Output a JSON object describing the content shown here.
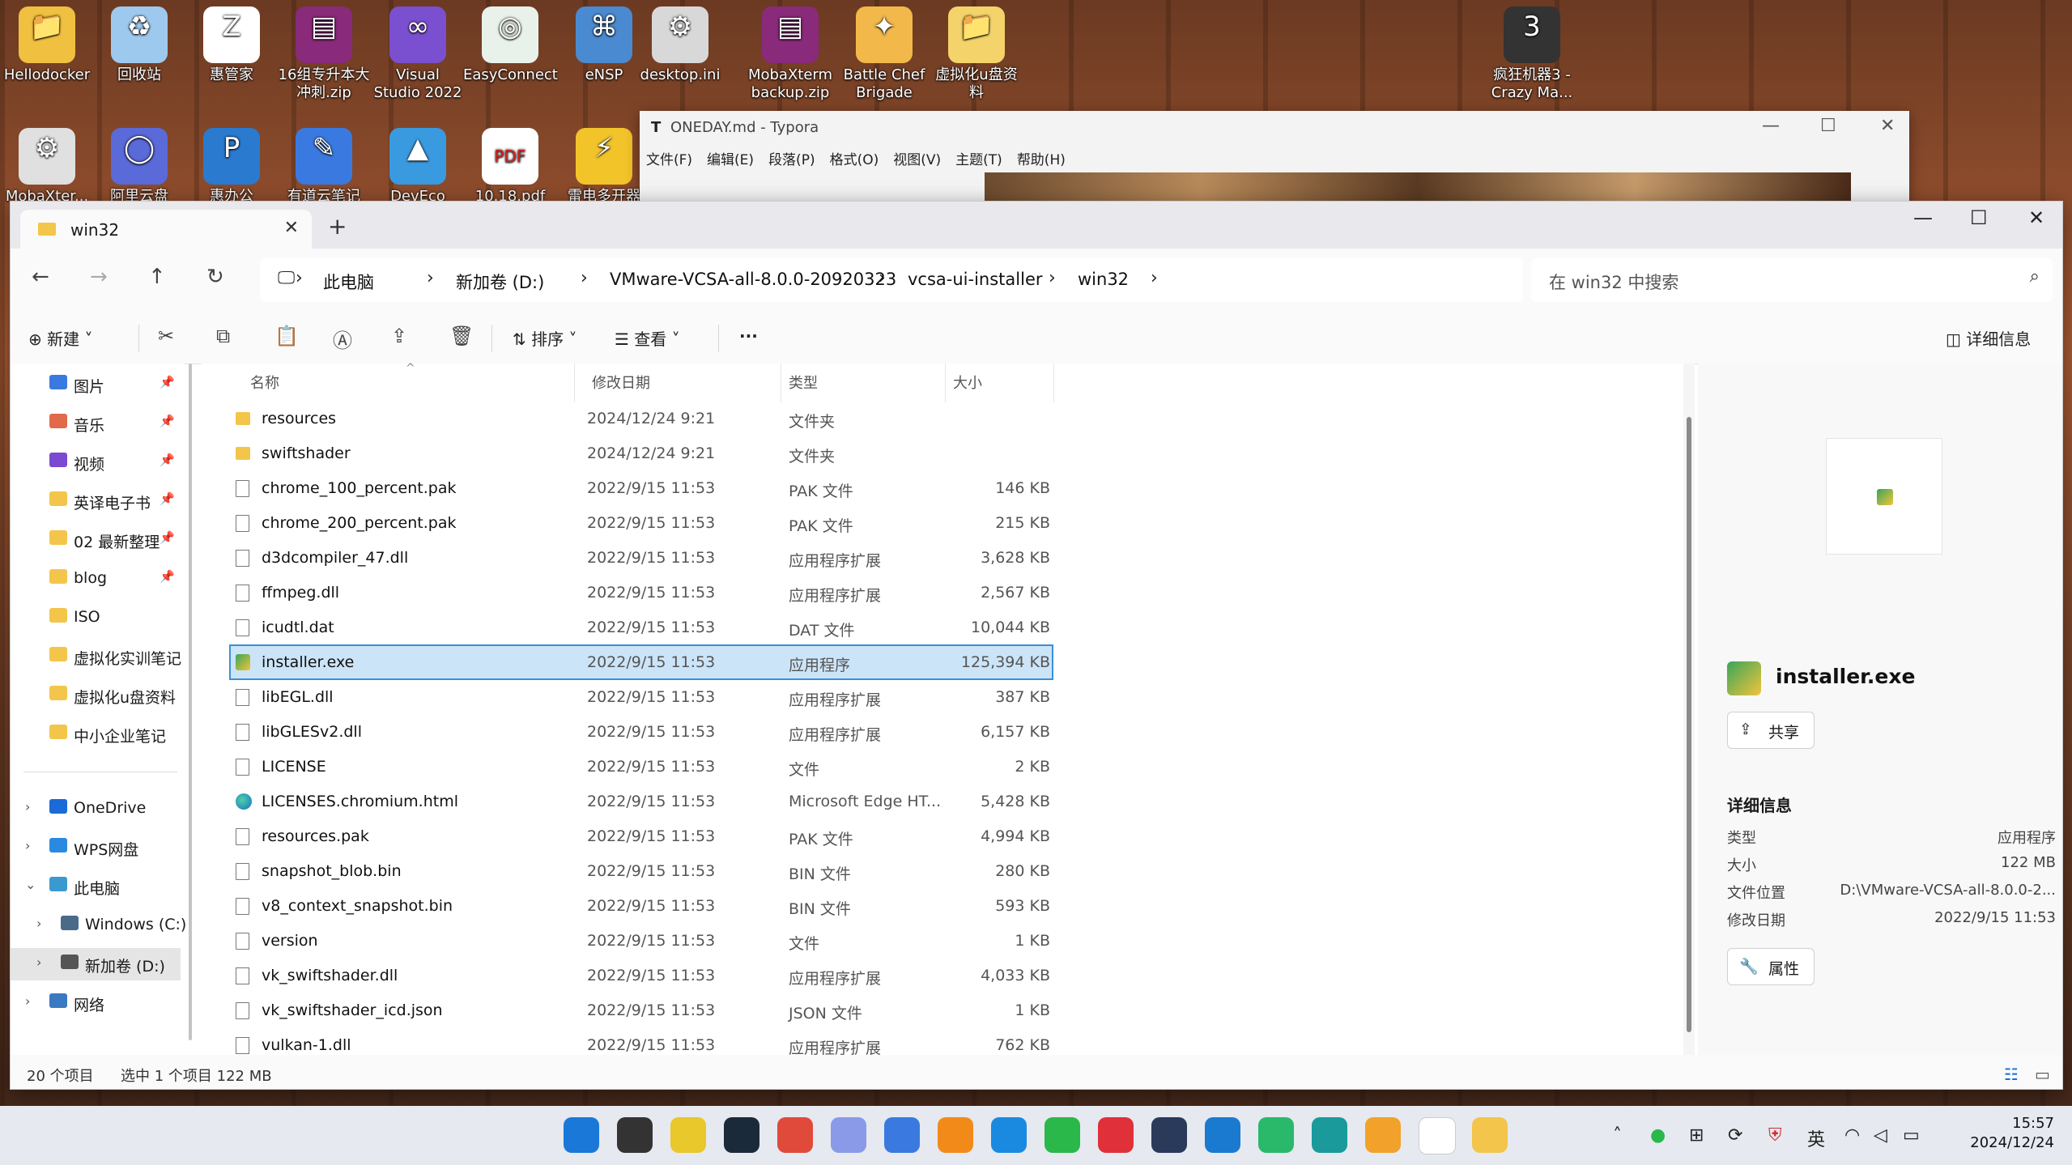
{
  "desktop_icons": [
    {
      "label": "Hellodocker",
      "color": "#f0c040",
      "glyph": "📁"
    },
    {
      "label": "回收站",
      "color": "#9ec9ef",
      "glyph": "♻"
    },
    {
      "label": "惠管家",
      "color": "#ffffff",
      "glyph": "Z"
    },
    {
      "label": "16组专升本大冲刺.zip",
      "color": "#8a2a7a",
      "glyph": "▤"
    },
    {
      "label": "Visual Studio 2022",
      "color": "#7a4fd0",
      "glyph": "∞"
    },
    {
      "label": "EasyConnect",
      "color": "#e8f2ea",
      "glyph": "◎"
    },
    {
      "label": "eNSP",
      "color": "#4a8ad0",
      "glyph": "⌘"
    },
    {
      "label": "desktop.ini",
      "color": "#d8d8d8",
      "glyph": "⚙"
    },
    {
      "label": "MobaXterm backup.zip",
      "color": "#8a2a7a",
      "glyph": "▤"
    },
    {
      "label": "Battle Chef Brigade",
      "color": "#f2b84a",
      "glyph": "✦"
    },
    {
      "label": "虚拟化u盘资料",
      "color": "#f3d36a",
      "glyph": "📁"
    },
    {
      "label": "疯狂机器3 - Crazy Ma...",
      "color": "#333333",
      "glyph": "3"
    },
    {
      "label": "MobaXter...",
      "color": "#e0e0e0",
      "glyph": "⚙"
    },
    {
      "label": "阿里云盘",
      "color": "#5a6ad8",
      "glyph": "◯"
    },
    {
      "label": "惠办公",
      "color": "#2a7ad0",
      "glyph": "P"
    },
    {
      "label": "有道云笔记",
      "color": "#3a7ae0",
      "glyph": "✎"
    },
    {
      "label": "DevEco",
      "color": "#3a9ae0",
      "glyph": "▲"
    },
    {
      "label": "10.18.pdf",
      "color": "#ffffff",
      "glyph": "PDF"
    },
    {
      "label": "雷电多开器",
      "color": "#f2c42a",
      "glyph": "⚡"
    }
  ],
  "typora": {
    "title": "ONEDAY.md - Typora",
    "logo": "T",
    "menu": [
      "文件(F)",
      "编辑(E)",
      "段落(P)",
      "格式(O)",
      "视图(V)",
      "主题(T)",
      "帮助(H)"
    ]
  },
  "explorer": {
    "tab_label": "win32",
    "breadcrumb": [
      "此电脑",
      "新加卷 (D:)",
      "VMware-VCSA-all-8.0.0-20920323",
      "vcsa-ui-installer",
      "win32"
    ],
    "search_placeholder": "在 win32 中搜索",
    "toolbar": {
      "new": "新建",
      "sort": "排序",
      "view": "查看",
      "more": "···",
      "details": "详细信息"
    },
    "sidebar": [
      {
        "label": "图片",
        "color": "#3a7ae0",
        "pinned": true
      },
      {
        "label": "音乐",
        "color": "#e06a4a",
        "pinned": true
      },
      {
        "label": "视频",
        "color": "#7a4ad0",
        "pinned": true
      },
      {
        "label": "英译电子书",
        "color": "#f3c54a",
        "pinned": true
      },
      {
        "label": "02 最新整理",
        "color": "#f3c54a",
        "pinned": true
      },
      {
        "label": "blog",
        "color": "#f3c54a",
        "pinned": true
      },
      {
        "label": "ISO",
        "color": "#f3c54a",
        "pinned": false
      },
      {
        "label": "虚拟化实训笔记",
        "color": "#f3c54a",
        "pinned": false
      },
      {
        "label": "虚拟化u盘资料",
        "color": "#f3c54a",
        "pinned": false
      },
      {
        "label": "中小企业笔记",
        "color": "#f3c54a",
        "pinned": false
      }
    ],
    "sidebar_tree": [
      {
        "label": "OneDrive",
        "color": "#1a6ad8",
        "expander": "›",
        "indent": 0
      },
      {
        "label": "WPS网盘",
        "color": "#2a8ae0",
        "expander": "›",
        "indent": 0
      },
      {
        "label": "此电脑",
        "color": "#3a9ad0",
        "expander": "⌄",
        "indent": 0
      },
      {
        "label": "Windows (C:)",
        "color": "#4a6a8a",
        "expander": "›",
        "indent": 1
      },
      {
        "label": "新加卷 (D:)",
        "color": "#555555",
        "expander": "›",
        "indent": 1,
        "selected": true
      },
      {
        "label": "网络",
        "color": "#3a7ac0",
        "expander": "›",
        "indent": 0
      }
    ],
    "columns": {
      "name": "名称",
      "date": "修改日期",
      "type": "类型",
      "size": "大小"
    },
    "files": [
      {
        "name": "resources",
        "date": "2024/12/24 9:21",
        "type": "文件夹",
        "size": "",
        "icon": "folder"
      },
      {
        "name": "swiftshader",
        "date": "2024/12/24 9:21",
        "type": "文件夹",
        "size": "",
        "icon": "folder"
      },
      {
        "name": "chrome_100_percent.pak",
        "date": "2022/9/15 11:53",
        "type": "PAK 文件",
        "size": "146 KB",
        "icon": "file"
      },
      {
        "name": "chrome_200_percent.pak",
        "date": "2022/9/15 11:53",
        "type": "PAK 文件",
        "size": "215 KB",
        "icon": "file"
      },
      {
        "name": "d3dcompiler_47.dll",
        "date": "2022/9/15 11:53",
        "type": "应用程序扩展",
        "size": "3,628 KB",
        "icon": "dll"
      },
      {
        "name": "ffmpeg.dll",
        "date": "2022/9/15 11:53",
        "type": "应用程序扩展",
        "size": "2,567 KB",
        "icon": "dll"
      },
      {
        "name": "icudtl.dat",
        "date": "2022/9/15 11:53",
        "type": "DAT 文件",
        "size": "10,044 KB",
        "icon": "file"
      },
      {
        "name": "installer.exe",
        "date": "2022/9/15 11:53",
        "type": "应用程序",
        "size": "125,394 KB",
        "icon": "exe",
        "selected": true
      },
      {
        "name": "libEGL.dll",
        "date": "2022/9/15 11:53",
        "type": "应用程序扩展",
        "size": "387 KB",
        "icon": "dll"
      },
      {
        "name": "libGLESv2.dll",
        "date": "2022/9/15 11:53",
        "type": "应用程序扩展",
        "size": "6,157 KB",
        "icon": "dll"
      },
      {
        "name": "LICENSE",
        "date": "2022/9/15 11:53",
        "type": "文件",
        "size": "2 KB",
        "icon": "file"
      },
      {
        "name": "LICENSES.chromium.html",
        "date": "2022/9/15 11:53",
        "type": "Microsoft Edge HT...",
        "size": "5,428 KB",
        "icon": "edge"
      },
      {
        "name": "resources.pak",
        "date": "2022/9/15 11:53",
        "type": "PAK 文件",
        "size": "4,994 KB",
        "icon": "file"
      },
      {
        "name": "snapshot_blob.bin",
        "date": "2022/9/15 11:53",
        "type": "BIN 文件",
        "size": "280 KB",
        "icon": "file"
      },
      {
        "name": "v8_context_snapshot.bin",
        "date": "2022/9/15 11:53",
        "type": "BIN 文件",
        "size": "593 KB",
        "icon": "file"
      },
      {
        "name": "version",
        "date": "2022/9/15 11:53",
        "type": "文件",
        "size": "1 KB",
        "icon": "file"
      },
      {
        "name": "vk_swiftshader.dll",
        "date": "2022/9/15 11:53",
        "type": "应用程序扩展",
        "size": "4,033 KB",
        "icon": "dll"
      },
      {
        "name": "vk_swiftshader_icd.json",
        "date": "2022/9/15 11:53",
        "type": "JSON 文件",
        "size": "1 KB",
        "icon": "file"
      },
      {
        "name": "vulkan-1.dll",
        "date": "2022/9/15 11:53",
        "type": "应用程序扩展",
        "size": "762 KB",
        "icon": "dll"
      }
    ],
    "details_pane": {
      "name": "installer.exe",
      "share": "共享",
      "heading": "详细信息",
      "props": [
        {
          "k": "类型",
          "v": "应用程序"
        },
        {
          "k": "大小",
          "v": "122 MB"
        },
        {
          "k": "文件位置",
          "v": "D:\\VMware-VCSA-all-8.0.0-2..."
        },
        {
          "k": "修改日期",
          "v": "2022/9/15 11:53"
        }
      ],
      "properties": "属性"
    },
    "status": {
      "count": "20 个项目",
      "selected": "选中 1 个项目  122 MB"
    }
  },
  "taskbar": {
    "apps": [
      {
        "name": "start",
        "color": "#1a78d8"
      },
      {
        "name": "task-view",
        "color": "#333333"
      },
      {
        "name": "app-yellow",
        "color": "#e8c82a"
      },
      {
        "name": "app-dark",
        "color": "#1a2a3a"
      },
      {
        "name": "chrome",
        "color": "#e04a3a"
      },
      {
        "name": "app-cloud",
        "color": "#8a9ae8"
      },
      {
        "name": "app-note",
        "color": "#3a7ae0"
      },
      {
        "name": "app-search",
        "color": "#f28a1a"
      },
      {
        "name": "app-star",
        "color": "#1a8ae0"
      },
      {
        "name": "wechat",
        "color": "#2ab84a"
      },
      {
        "name": "netease",
        "color": "#e0303a"
      },
      {
        "name": "app-circle",
        "color": "#2a3a5a"
      },
      {
        "name": "vscode",
        "color": "#1a7ad0"
      },
      {
        "name": "app-x",
        "color": "#2ab86a"
      },
      {
        "name": "edge",
        "color": "#1a9a9a"
      },
      {
        "name": "app-vm",
        "color": "#f2a22a"
      },
      {
        "name": "typora",
        "color": "#ffffff"
      },
      {
        "name": "file-explorer",
        "color": "#f3c54a"
      }
    ],
    "ime": "英",
    "time": "15:57",
    "date": "2024/12/24"
  }
}
